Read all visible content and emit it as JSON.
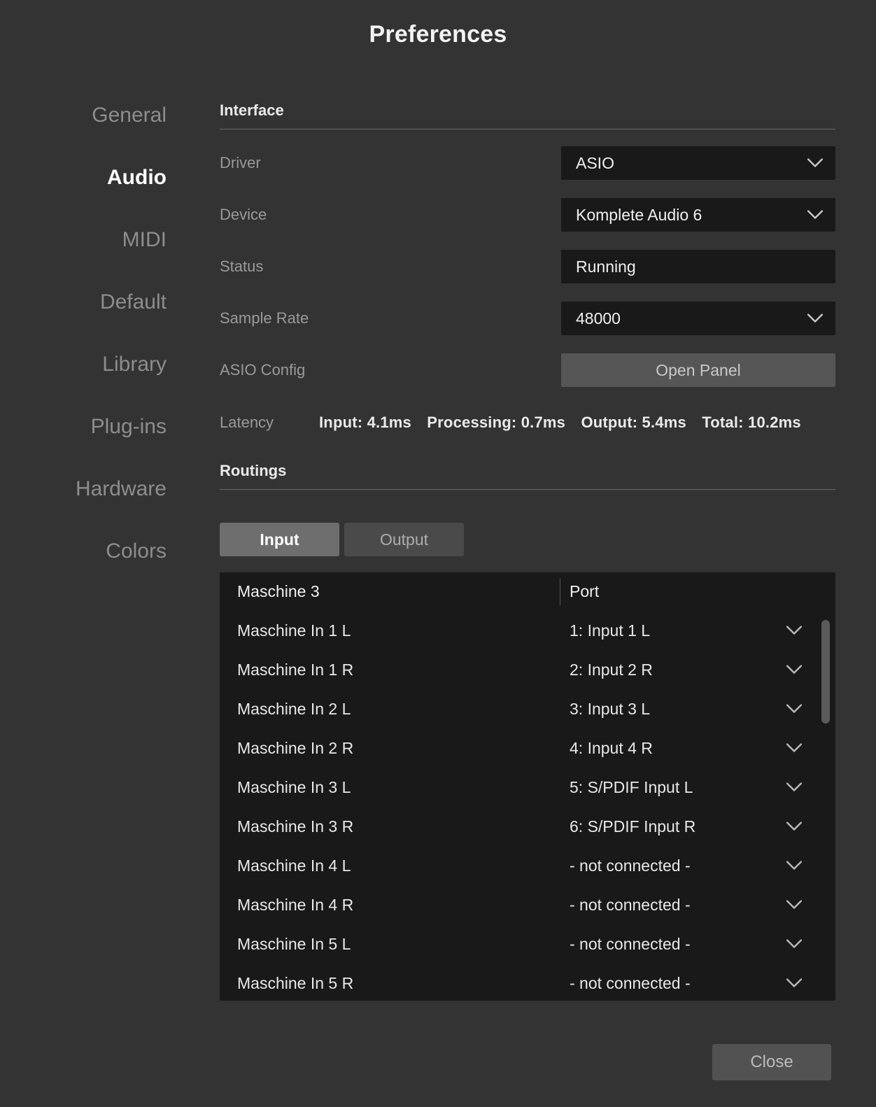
{
  "dialog": {
    "title": "Preferences"
  },
  "sidebar": {
    "items": [
      {
        "label": "General",
        "active": false
      },
      {
        "label": "Audio",
        "active": true
      },
      {
        "label": "MIDI",
        "active": false
      },
      {
        "label": "Default",
        "active": false
      },
      {
        "label": "Library",
        "active": false
      },
      {
        "label": "Plug-ins",
        "active": false
      },
      {
        "label": "Hardware",
        "active": false
      },
      {
        "label": "Colors",
        "active": false
      }
    ]
  },
  "interface": {
    "heading": "Interface",
    "driver": {
      "label": "Driver",
      "value": "ASIO",
      "icon": "chevron-down-icon"
    },
    "device": {
      "label": "Device",
      "value": "Komplete Audio 6",
      "icon": "chevron-down-icon"
    },
    "status": {
      "label": "Status",
      "value": "Running"
    },
    "sample_rate": {
      "label": "Sample Rate",
      "value": "48000",
      "icon": "chevron-down-icon"
    },
    "asio_config": {
      "label": "ASIO Config",
      "button_label": "Open Panel"
    },
    "latency": {
      "label": "Latency",
      "input": "Input: 4.1ms",
      "processing": "Processing: 0.7ms",
      "output": "Output: 5.4ms",
      "total": "Total: 10.2ms"
    }
  },
  "routings": {
    "heading": "Routings",
    "tabs": [
      {
        "label": "Input",
        "active": true
      },
      {
        "label": "Output",
        "active": false
      }
    ],
    "table": {
      "columns": [
        "Maschine 3",
        "Port"
      ],
      "rows": [
        {
          "name": "Maschine In 1 L",
          "port": "1: Input 1 L"
        },
        {
          "name": "Maschine In 1 R",
          "port": "2: Input 2 R"
        },
        {
          "name": "Maschine In 2 L",
          "port": "3: Input 3 L"
        },
        {
          "name": "Maschine In 2 R",
          "port": "4: Input 4 R"
        },
        {
          "name": "Maschine In 3 L",
          "port": "5: S/PDIF Input L"
        },
        {
          "name": "Maschine In 3 R",
          "port": "6: S/PDIF Input R"
        },
        {
          "name": "Maschine In 4 L",
          "port": "- not connected -"
        },
        {
          "name": "Maschine In 4 R",
          "port": "- not connected -"
        },
        {
          "name": "Maschine In 5 L",
          "port": "- not connected -"
        },
        {
          "name": "Maschine In 5 R",
          "port": "- not connected -"
        }
      ]
    }
  },
  "footer": {
    "close_label": "Close"
  },
  "colors": {
    "background": "#333333",
    "field_background": "#191919",
    "button": "#565656",
    "tab_active": "#6e6e6e",
    "tab_inactive": "#4a4a4a",
    "text_primary": "#f0f0f0",
    "text_muted": "#9a9a9a"
  }
}
